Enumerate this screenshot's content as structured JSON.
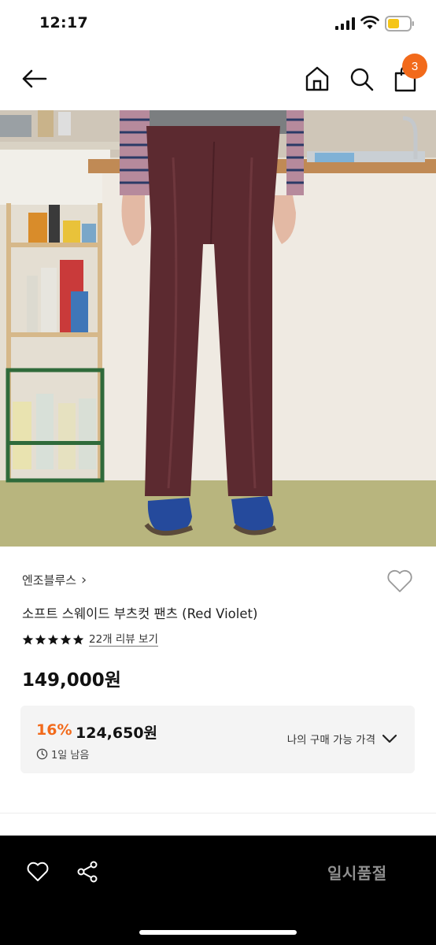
{
  "status_bar": {
    "time": "12:17"
  },
  "nav": {
    "cart_count": "3"
  },
  "product": {
    "brand": "엔조블루스",
    "brand_chevron": "›",
    "name": "소프트 스웨이드 부츠컷 팬츠 (Red Violet)",
    "rating_stars": 5,
    "review_link": "22개 리뷰 보기",
    "price": "149,000원"
  },
  "discount": {
    "rate": "16%",
    "price": "124,650원",
    "time_left": "1일 남음",
    "my_price_label": "나의 구매 가능 가격"
  },
  "bottom_bar": {
    "sold_out_label": "일시품절"
  },
  "colors": {
    "accent": "#f26a1b",
    "bottom_bar": "#000000",
    "discount_box": "#f4f4f4"
  }
}
